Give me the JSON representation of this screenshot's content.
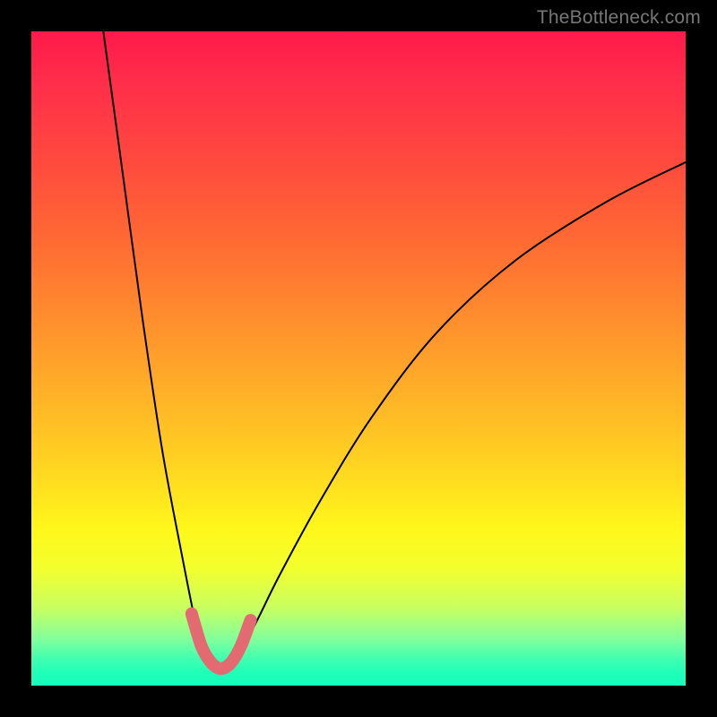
{
  "watermark": "TheBottleneck.com",
  "colors": {
    "curve": "#000000",
    "highlight": "#e46a72",
    "frame": "#000000"
  },
  "chart_data": {
    "type": "line",
    "title": "",
    "xlabel": "",
    "ylabel": "",
    "xlim": [
      0,
      100
    ],
    "ylim": [
      0,
      100
    ],
    "description": "Bottleneck-style V curve: two steep arms meeting near a minimum; lower values (near the trough) indicate balance. Pink band marks ~balanced region near the trough.",
    "series": [
      {
        "name": "left-arm",
        "x": [
          11,
          14,
          17,
          20,
          23,
          25,
          26,
          27,
          28,
          29
        ],
        "y": [
          100,
          78,
          56,
          36,
          20,
          10,
          6,
          4,
          3,
          2.5
        ]
      },
      {
        "name": "right-arm",
        "x": [
          29,
          31,
          34,
          38,
          44,
          52,
          62,
          74,
          88,
          100
        ],
        "y": [
          2.5,
          4,
          9,
          17,
          28,
          41,
          54,
          65,
          74,
          80
        ]
      },
      {
        "name": "highlight-band",
        "x": [
          24.5,
          26,
          27.5,
          29,
          30.5,
          32,
          33.5
        ],
        "y": [
          11,
          6,
          3.5,
          2.6,
          3.5,
          6,
          10
        ]
      }
    ]
  }
}
